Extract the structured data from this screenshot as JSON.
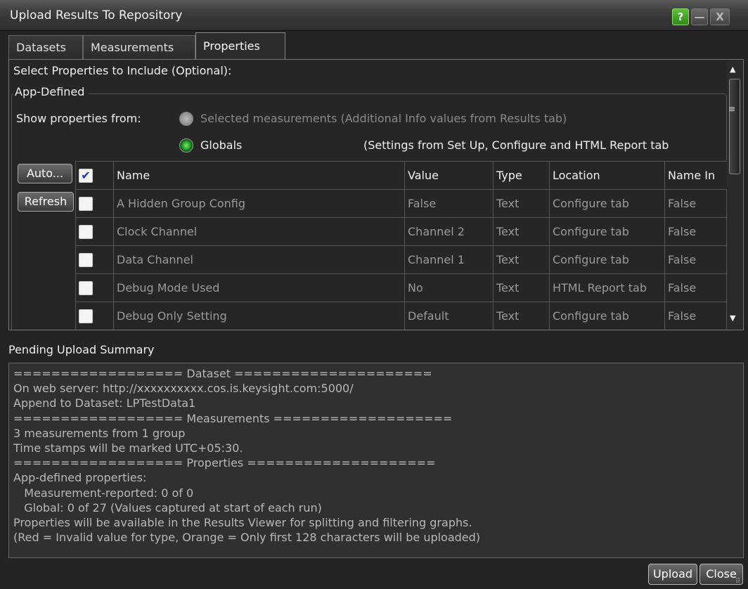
{
  "window": {
    "title": "Upload Results To Repository",
    "help_label": "?",
    "minimize_label": "—",
    "close_label": "X"
  },
  "tabs": [
    {
      "label": "Datasets"
    },
    {
      "label": "Measurements"
    },
    {
      "label": "Properties"
    }
  ],
  "properties": {
    "select_label": "Select Properties to Include (Optional):",
    "group_label": "App-Defined",
    "show_from_label": "Show properties from:",
    "option_selected_measurements": "Selected measurements (Additional Info values from Results tab)",
    "option_globals": "Globals",
    "globals_note": "(Settings from Set Up, Configure and HTML Report tab",
    "auto_button": "Auto...",
    "refresh_button": "Refresh",
    "header_check": "✔",
    "columns": {
      "name": "Name",
      "value": "Value",
      "type": "Type",
      "location": "Location",
      "name_in": "Name In"
    },
    "rows": [
      {
        "name": "A Hidden Group Config",
        "value": "False",
        "type": "Text",
        "location": "Configure tab",
        "name_in": "False"
      },
      {
        "name": "Clock Channel",
        "value": "Channel 2",
        "type": "Text",
        "location": "Configure tab",
        "name_in": "False"
      },
      {
        "name": "Data Channel",
        "value": "Channel 1",
        "type": "Text",
        "location": "Configure tab",
        "name_in": "False"
      },
      {
        "name": "Debug Mode Used",
        "value": "No",
        "type": "Text",
        "location": "HTML Report tab",
        "name_in": "False"
      },
      {
        "name": "Debug Only Setting",
        "value": "Default",
        "type": "Text",
        "location": "Configure tab",
        "name_in": "False"
      }
    ]
  },
  "summary": {
    "title": "Pending Upload Summary",
    "lines": [
      "================== Dataset =====================",
      "On web server: http://xxxxxxxxxx.cos.is.keysight.com:5000/",
      "Append to Dataset: LPTestData1",
      "================== Measurements ===================",
      "3 measurements from 1 group",
      "Time stamps will be marked UTC+05:30.",
      "================== Properties ====================",
      "App-defined properties:",
      "   Measurement-reported: 0 of 0",
      "   Global: 0 of 27 (Values captured at start of each run)",
      "Properties will be available in the Results Viewer for splitting and filtering graphs.",
      "(Red = Invalid value for type, Orange = Only first 128 characters will be uploaded)"
    ]
  },
  "footer": {
    "upload_button": "Upload",
    "close_button": "Close"
  }
}
